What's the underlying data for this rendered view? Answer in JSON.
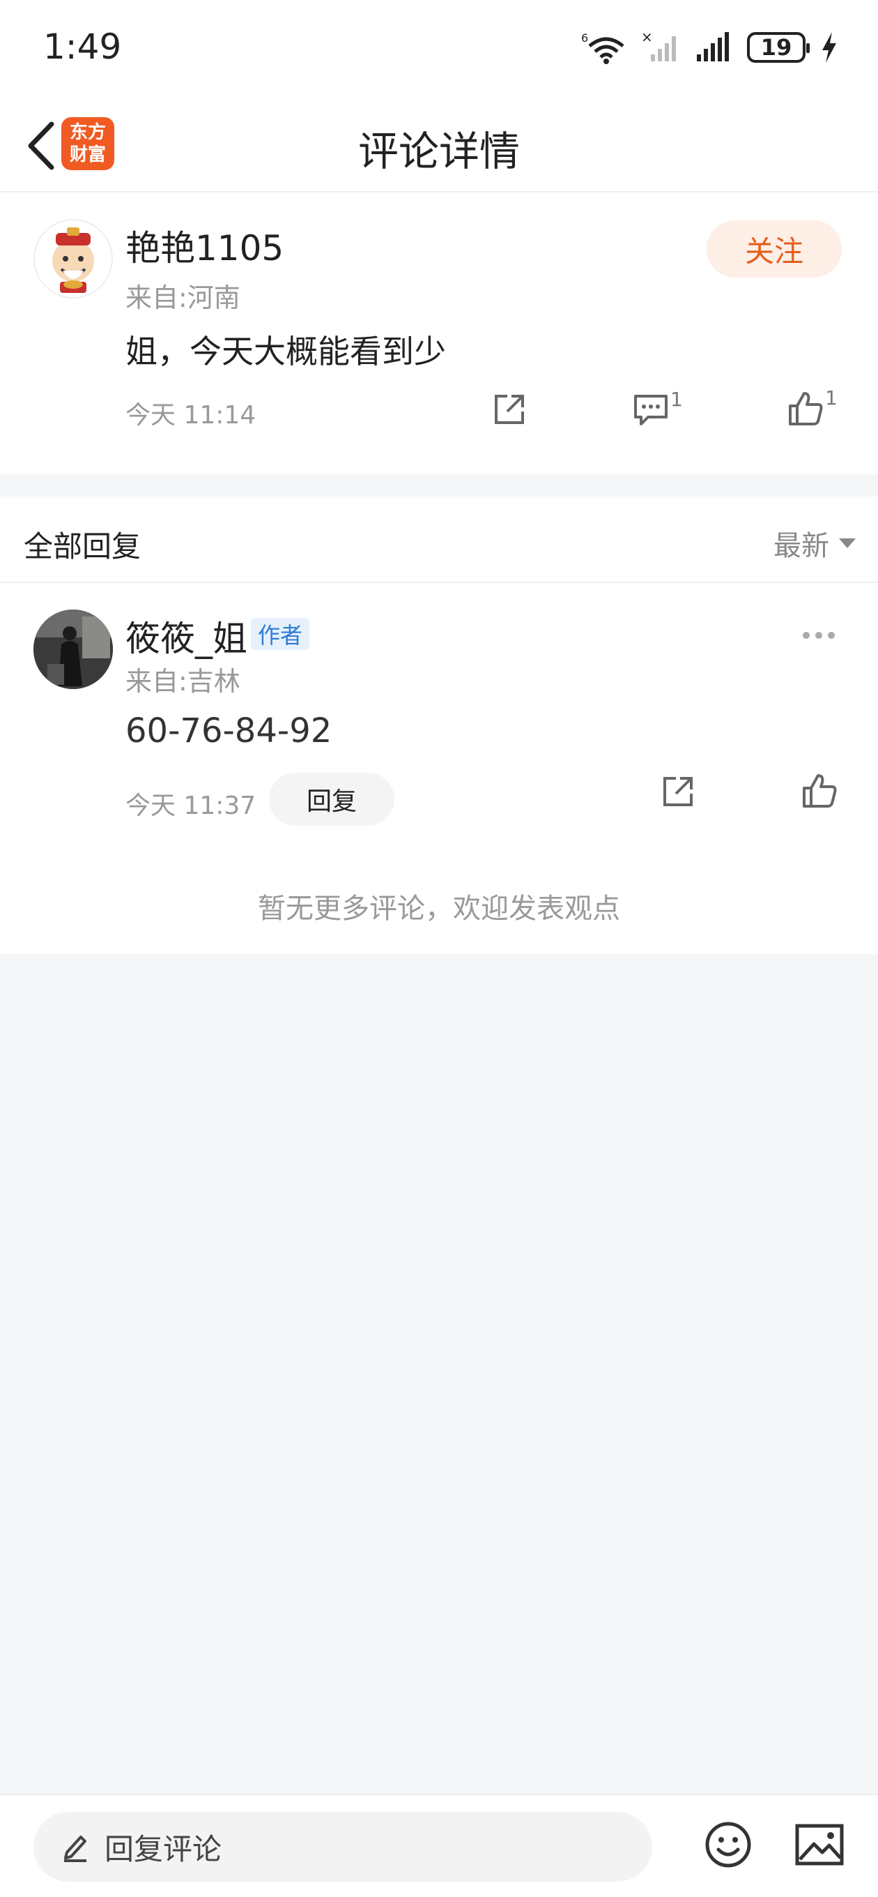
{
  "status_bar": {
    "time": "1:49",
    "battery": "19",
    "network_label": "6"
  },
  "nav": {
    "title": "评论详情",
    "logo_text": "东方\n财富"
  },
  "main_comment": {
    "user_name": "艳艳1105",
    "location": "来自:河南",
    "text": "姐，今天大概能看到少",
    "time": "今天 11:14",
    "follow_label": "关注",
    "comment_count": "1",
    "like_count": "1"
  },
  "replies": {
    "title": "全部回复",
    "sort_label": "最新",
    "items": [
      {
        "user_name": "筱筱_姐",
        "badge": "作者",
        "location": "来自:吉林",
        "text": "60-76-84-92",
        "time": "今天 11:37",
        "reply_label": "回复"
      }
    ],
    "no_more_text": "暂无更多评论，欢迎发表观点"
  },
  "bottom_bar": {
    "input_placeholder": "回复评论"
  },
  "colors": {
    "accent": "#e45f1c",
    "logo_bg": "#f15a22",
    "badge_text": "#2f7bd3"
  },
  "icons": [
    "back-icon",
    "share-icon",
    "comment-icon",
    "like-icon",
    "more-icon",
    "edit-icon",
    "emoji-icon",
    "image-icon"
  ]
}
